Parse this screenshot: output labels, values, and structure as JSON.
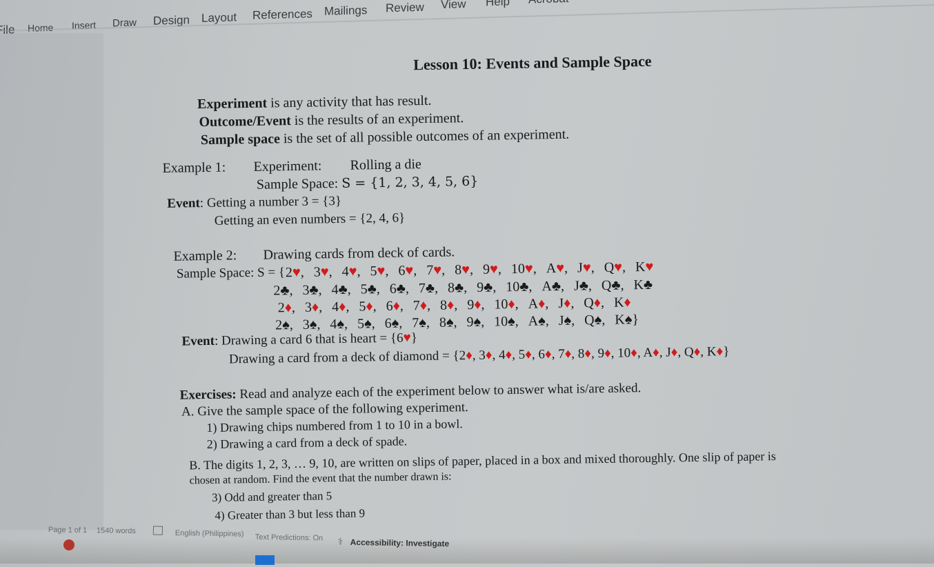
{
  "app": {
    "ribbon_tabs": [
      "File",
      "Home",
      "Insert",
      "Draw",
      "Design",
      "Layout",
      "References",
      "Mailings",
      "Review",
      "View",
      "Help",
      "Acrobat"
    ]
  },
  "document": {
    "title": "Lesson 10: Events and Sample Space",
    "definitions": [
      {
        "term": "Experiment",
        "text": " is any activity that has result."
      },
      {
        "term": "Outcome/Event",
        "text": " is the results of an experiment."
      },
      {
        "term": "Sample space",
        "text": " is the set of all possible outcomes of an experiment."
      }
    ],
    "example1": {
      "label": "Example 1:",
      "experiment_label": "Experiment:",
      "experiment_value": "Rolling a die",
      "sample_space_label": "Sample Space:",
      "sample_space_value": "S = {1, 2, 3, 4, 5, 6}",
      "event_label": "Event",
      "event1": ": Getting a number 3 = {3}",
      "event2": "Getting an even numbers = {2, 4, 6}"
    },
    "example2": {
      "label": "Example 2:",
      "description": "Drawing cards from deck of cards.",
      "sample_space_label": "Sample Space: ",
      "set_prefix": "S = {",
      "ranks": [
        "2",
        "3",
        "4",
        "5",
        "6",
        "7",
        "8",
        "9",
        "10",
        "A",
        "J",
        "Q",
        "K"
      ],
      "suits": [
        {
          "name": "heart",
          "symbol": "♥"
        },
        {
          "name": "club",
          "symbol": "♣"
        },
        {
          "name": "diamond",
          "symbol": "♦"
        },
        {
          "name": "spade",
          "symbol": "♠"
        }
      ],
      "event_label": "Event",
      "event1_text": ": Drawing a card 6 that is heart = {6",
      "event1_symbol": "♥",
      "event1_close": "}",
      "event2_text": "Drawing a card from a deck of diamond = {",
      "event2_close": "}"
    },
    "exercises": {
      "label": "Exercises:",
      "intro": " Read and analyze each of the experiment below to answer what is/are asked.",
      "partA": "A. Give the sample space of the following experiment.",
      "items_a": [
        "1)  Drawing chips numbered from 1 to 10 in a bowl.",
        "2)  Drawing a card from a deck of spade."
      ],
      "partB_line1": "B. The digits 1, 2, 3, … 9, 10, are written on slips of paper, placed in a box and mixed thoroughly.  One slip of paper is",
      "partB_line2": "chosen at random.  Find the event that the number drawn is:",
      "items_b": [
        "3)  Odd and greater than 5",
        "4)  Greater than 3 but less than 9"
      ]
    }
  },
  "status_bar": {
    "page": "Page 1 of 1",
    "words": "1540 words",
    "language": "English (Philippines)",
    "text_predictions": "Text Predictions: On",
    "accessibility": "Accessibility: Investigate"
  },
  "colors": {
    "red_suit": "#d01c1c",
    "black_suit": "#1a1a1a"
  }
}
